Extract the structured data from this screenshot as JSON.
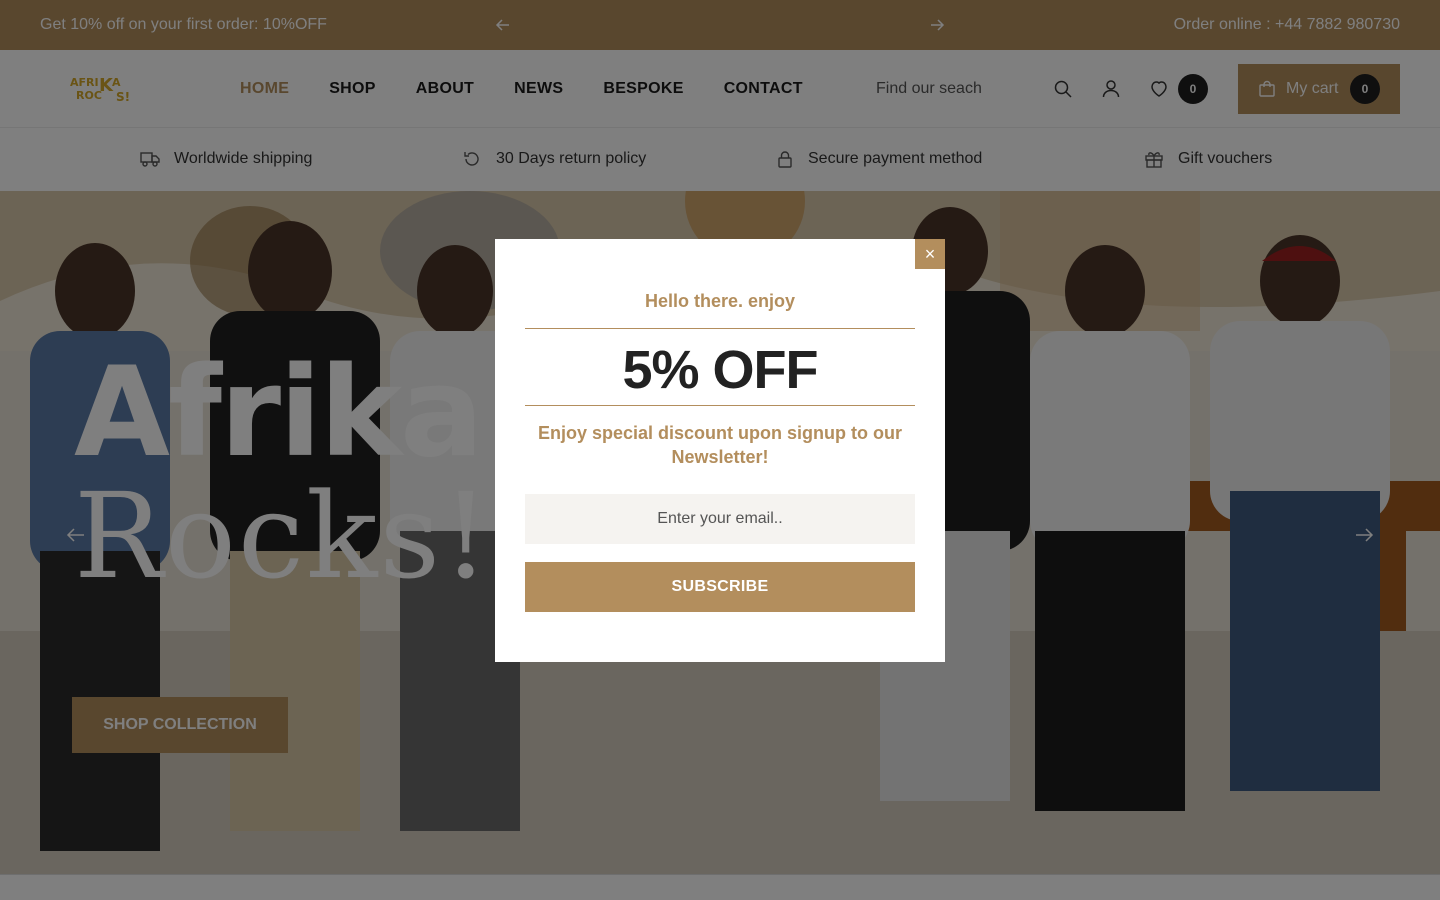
{
  "announcement": {
    "promo_text": "Get 10% off on your first order: 10%OFF",
    "order_online": "Order online :  +44 7882 980730"
  },
  "header": {
    "logo_line1": "AFRIKA",
    "logo_line2": "ROCKS!",
    "nav": [
      {
        "label": "HOME",
        "active": true
      },
      {
        "label": "SHOP"
      },
      {
        "label": "ABOUT"
      },
      {
        "label": "NEWS"
      },
      {
        "label": "BESPOKE"
      },
      {
        "label": "CONTACT"
      }
    ],
    "search_placeholder": "Find our seach",
    "wishlist_count": "0",
    "cart_label": "My cart",
    "cart_count": "0"
  },
  "features": [
    {
      "label": "Worldwide shipping",
      "icon": "truck-icon"
    },
    {
      "label": "30 Days return policy",
      "icon": "return-icon"
    },
    {
      "label": "Secure payment method",
      "icon": "lock-icon"
    },
    {
      "label": "Gift vouchers",
      "icon": "gift-icon"
    }
  ],
  "hero": {
    "title_line1": "Afrika",
    "title_line2": "Rocks!",
    "button_label": "SHOP COLLECTION"
  },
  "popup": {
    "close_symbol": "×",
    "greeting": "Hello there. enjoy",
    "offer": "5% OFF",
    "description": "Enjoy special discount upon signup to our Newsletter!",
    "email_placeholder": "Enter your email..",
    "subscribe_label": "SUBSCRIBE"
  },
  "colors": {
    "accent": "#b38e5d",
    "dark": "#1f1f1f",
    "overlay": "rgba(0,0,0,0.5)"
  }
}
